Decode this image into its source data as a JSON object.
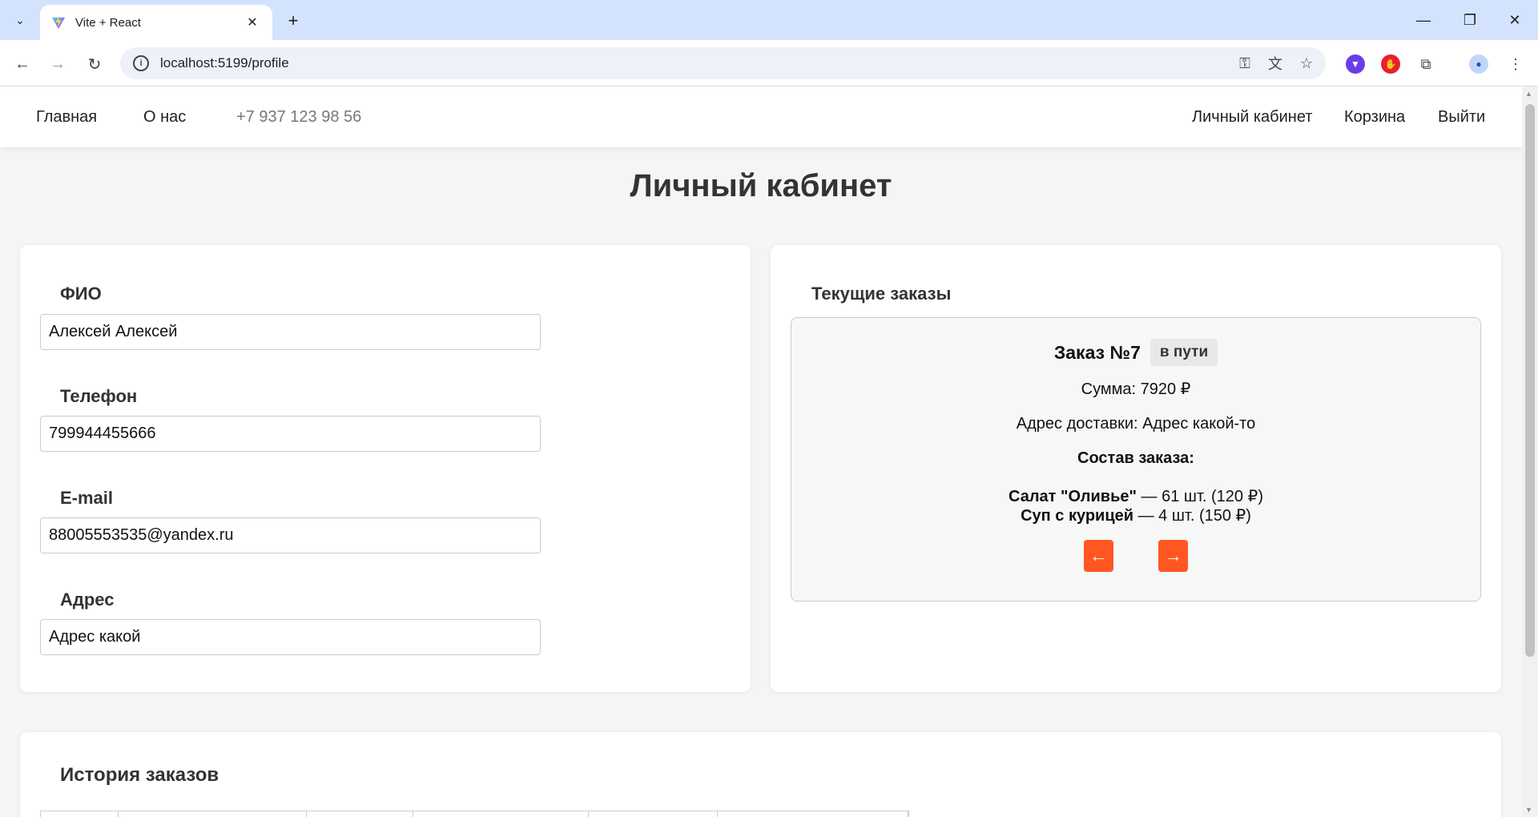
{
  "browser": {
    "tab_title": "Vite + React",
    "url": "localhost:5199/profile"
  },
  "header": {
    "nav_home": "Главная",
    "nav_about": "О нас",
    "phone": "+7 937 123 98 56",
    "nav_account": "Личный кабинет",
    "nav_cart": "Корзина",
    "nav_logout": "Выйти"
  },
  "page": {
    "title": "Личный кабинет"
  },
  "profile": {
    "fio_label": "ФИО",
    "fio_value": "Алексей Алексей",
    "phone_label": "Телефон",
    "phone_value": "799944455666",
    "email_label": "E-mail",
    "email_value": "88005553535@yandex.ru",
    "address_label": "Адрес",
    "address_value": "Адрес какой"
  },
  "current_orders": {
    "title": "Текущие заказы",
    "order": {
      "number": "Заказ №7",
      "status": "в пути",
      "sum": "Сумма: 7920 ₽",
      "address": "Адрес доставки: Адрес какой-то",
      "composition_label": "Состав заказа:",
      "items": [
        {
          "name": "Салат \"Оливье\"",
          "detail": " — 61 шт. (120 ₽)"
        },
        {
          "name": "Суп с курицей",
          "detail": " — 4 шт. (150 ₽)"
        }
      ]
    },
    "prev_label": "←",
    "next_label": "→"
  },
  "history": {
    "title": "История заказов"
  },
  "colors": {
    "accent": "#ff5722",
    "background": "#f5f5f5",
    "card": "#ffffff"
  }
}
